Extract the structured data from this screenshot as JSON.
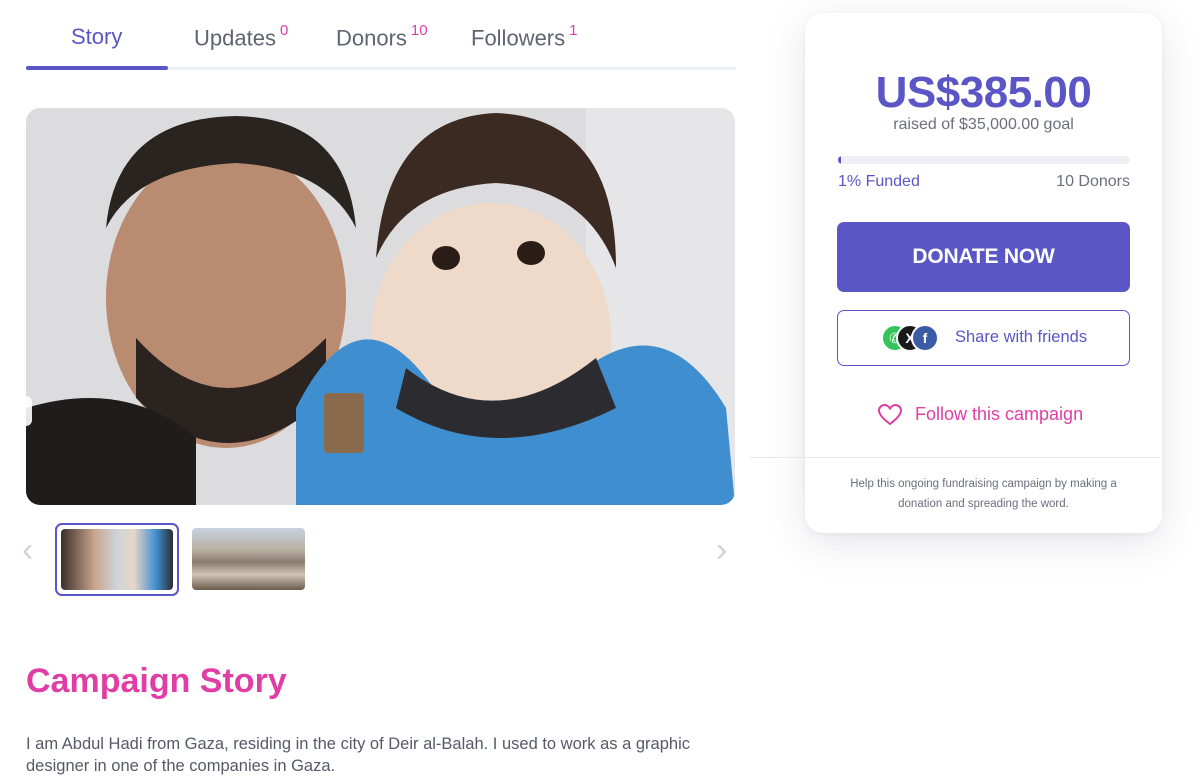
{
  "tabs": [
    {
      "label": "Story",
      "count": ""
    },
    {
      "label": "Updates",
      "count": "0"
    },
    {
      "label": "Donors",
      "count": "10"
    },
    {
      "label": "Followers",
      "count": "1"
    }
  ],
  "donation": {
    "amount": "US$385.00",
    "raised_text": "raised of $35,000.00 goal",
    "progress_percent": 1,
    "funded_text": "1% Funded",
    "donors_text": "10 Donors",
    "donate_label": "DONATE NOW",
    "share_label": "Share with friends",
    "follow_label": "Follow this campaign",
    "help_text": "Help this ongoing fundraising campaign by making a donation and spreading the word."
  },
  "story": {
    "title": "Campaign Story",
    "text": "I am Abdul Hadi from Gaza, residing in the city of Deir al-Balah. I used to work as a graphic designer in one of the companies in Gaza."
  },
  "colors": {
    "accent": "#5a56c6",
    "pink": "#e03ea5"
  }
}
